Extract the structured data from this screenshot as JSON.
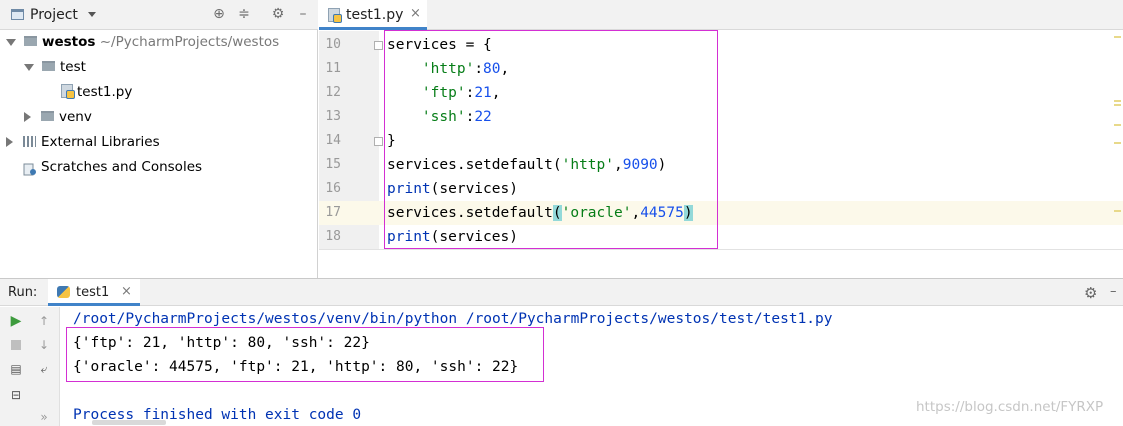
{
  "project_panel": {
    "title": "Project",
    "tree": [
      {
        "name": "westos",
        "path": "~/PycharmProjects/westos",
        "type": "folder",
        "expanded": true
      },
      {
        "name": "test",
        "type": "folder",
        "expanded": true
      },
      {
        "name": "test1.py",
        "type": "python-file"
      },
      {
        "name": "venv",
        "type": "folder",
        "expanded": false
      },
      {
        "name": "External Libraries",
        "type": "library",
        "expanded": false
      },
      {
        "name": "Scratches and Consoles",
        "type": "scratches"
      }
    ]
  },
  "editor": {
    "tab_label": "test1.py",
    "current_line": 17,
    "lines": [
      {
        "number": "10"
      },
      {
        "number": "11"
      },
      {
        "number": "12"
      },
      {
        "number": "13"
      },
      {
        "number": "14"
      },
      {
        "number": "15"
      },
      {
        "number": "16"
      },
      {
        "number": "17"
      },
      {
        "number": "18"
      }
    ],
    "code": {
      "l10": "services = {",
      "l11_key": "'http'",
      "l11_val": "80",
      "l12_key": "'ftp'",
      "l12_val": "21",
      "l13_key": "'ssh'",
      "l13_val": "22",
      "l14": "}",
      "l15_call": "services.setdefault(",
      "l15_key": "'http'",
      "l15_val": "9090",
      "l16_fn": "print",
      "l16_arg": "(services)",
      "l17_call": "services.setdefault",
      "l17_key": "'oracle'",
      "l17_val": "44575",
      "l18_fn": "print",
      "l18_arg": "(services)"
    }
  },
  "run_panel": {
    "label": "Run:",
    "tab_label": "test1",
    "console": {
      "command": "/root/PycharmProjects/westos/venv/bin/python /root/PycharmProjects/westos/test/test1.py",
      "output_1": "{'ftp': 21, 'http': 80, 'ssh': 22}",
      "output_2": "{'oracle': 44575, 'ftp': 21, 'http': 80, 'ssh': 22}",
      "finished": "Process finished with exit code 0"
    }
  },
  "watermark": "https://blog.csdn.net/FYRXP",
  "colors": {
    "highlight_box": "#d32fd3",
    "string": "#067d17",
    "number": "#1750eb",
    "keyword": "#0033b3",
    "tab_underline": "#4083c9"
  },
  "icons": [
    "folder-icon",
    "crosshair-icon",
    "collapse-icon",
    "gear-icon",
    "minimize-icon",
    "python-file-icon",
    "library-icon",
    "scratches-icon",
    "run-icon",
    "stop-icon",
    "up-arrow-icon",
    "down-arrow-icon",
    "layout-icon",
    "wrap-icon",
    "pin-icon"
  ]
}
